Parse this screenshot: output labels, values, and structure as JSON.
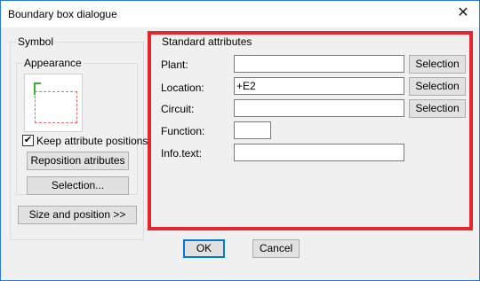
{
  "window": {
    "title": "Boundary box dialogue"
  },
  "symbol": {
    "group_label": "Symbol",
    "appearance_label": "Appearance",
    "keep_label": "Keep attribute positions",
    "keep_checked_glyph": "✔",
    "reposition_label": "Reposition atributes",
    "selection_label": "Selection...",
    "size_label": "Size and position >>"
  },
  "standard": {
    "group_label": "Standard attributes",
    "plant": {
      "label": "Plant:",
      "value": "",
      "button": "Selection"
    },
    "location": {
      "label": "Location:",
      "value": "+E2",
      "button": "Selection"
    },
    "circuit": {
      "label": "Circuit:",
      "value": "",
      "button": "Selection"
    },
    "function": {
      "label": "Function:",
      "value": ""
    },
    "info": {
      "label": "Info.text:",
      "value": ""
    }
  },
  "footer": {
    "ok": "OK",
    "cancel": "Cancel"
  },
  "colors": {
    "highlight": "#e5262e",
    "title_border": "#2b79d8"
  }
}
